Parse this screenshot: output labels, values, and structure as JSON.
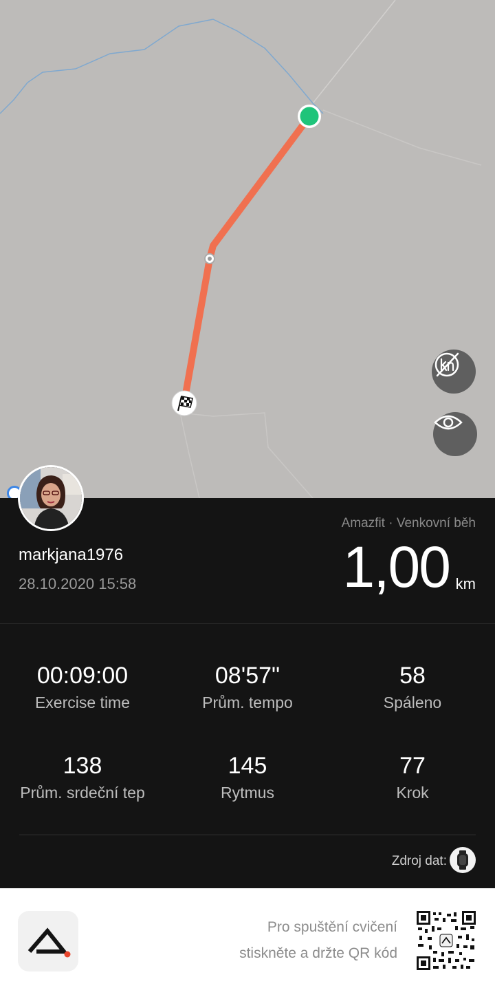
{
  "map": {
    "km_toggle_icon": "km-markers-off-icon",
    "visibility_icon": "eye-icon",
    "start_marker_icon": "green-dot-icon",
    "finish_marker_icon": "checkered-flag-icon",
    "route_color": "#f07050",
    "start_color": "#1fc47a"
  },
  "user": {
    "username": "markjana1976",
    "datetime": "28.10.2020 15:58"
  },
  "workout": {
    "source": "Amazfit · Venkovní běh",
    "distance": "1,00",
    "distance_unit": "km"
  },
  "stats": [
    {
      "value": "00:09:00",
      "label": "Exercise time"
    },
    {
      "value": "08'57\"",
      "label": "Prům. tempo"
    },
    {
      "value": "58",
      "label": "Spáleno"
    },
    {
      "value": "138",
      "label": "Prům. srdeční tep"
    },
    {
      "value": "145",
      "label": "Rytmus"
    },
    {
      "value": "77",
      "label": "Krok"
    }
  ],
  "data_source": {
    "label": "Zdroj dat:",
    "icon": "watch-icon"
  },
  "footer": {
    "line1": "Pro spuštění cvičení",
    "line2": "stiskněte a držte QR kód",
    "logo_icon": "amazfit-logo-icon",
    "qr_icon": "qr-code-icon"
  }
}
